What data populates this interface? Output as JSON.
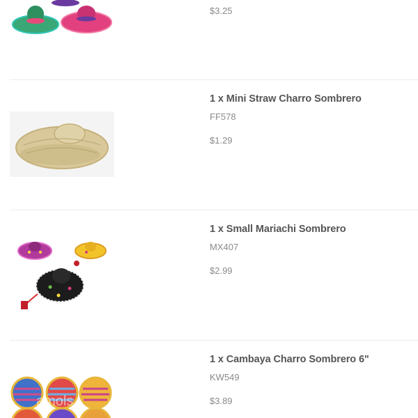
{
  "cart": {
    "items": [
      {
        "quantity_name": "",
        "sku": "",
        "price": "$3.25",
        "image_icon": "colorful-sombreros-icon"
      },
      {
        "quantity_name": "1 x Mini Straw Charro Sombrero",
        "sku": "FF578",
        "price": "$1.29",
        "image_icon": "straw-sombrero-icon"
      },
      {
        "quantity_name": "1 x Small Mariachi Sombrero",
        "sku": "MX407",
        "price": "$2.99",
        "image_icon": "mariachi-sombreros-icon"
      },
      {
        "quantity_name": "1 x Cambaya Charro Sombrero 6\"",
        "sku": "KW549",
        "price": "$3.89",
        "image_icon": "cambaya-sombreros-icon",
        "watermark": "amols"
      }
    ]
  },
  "colors": {
    "name_text": "#555555",
    "muted_text": "#8a8a8a",
    "divider": "#ececec"
  }
}
